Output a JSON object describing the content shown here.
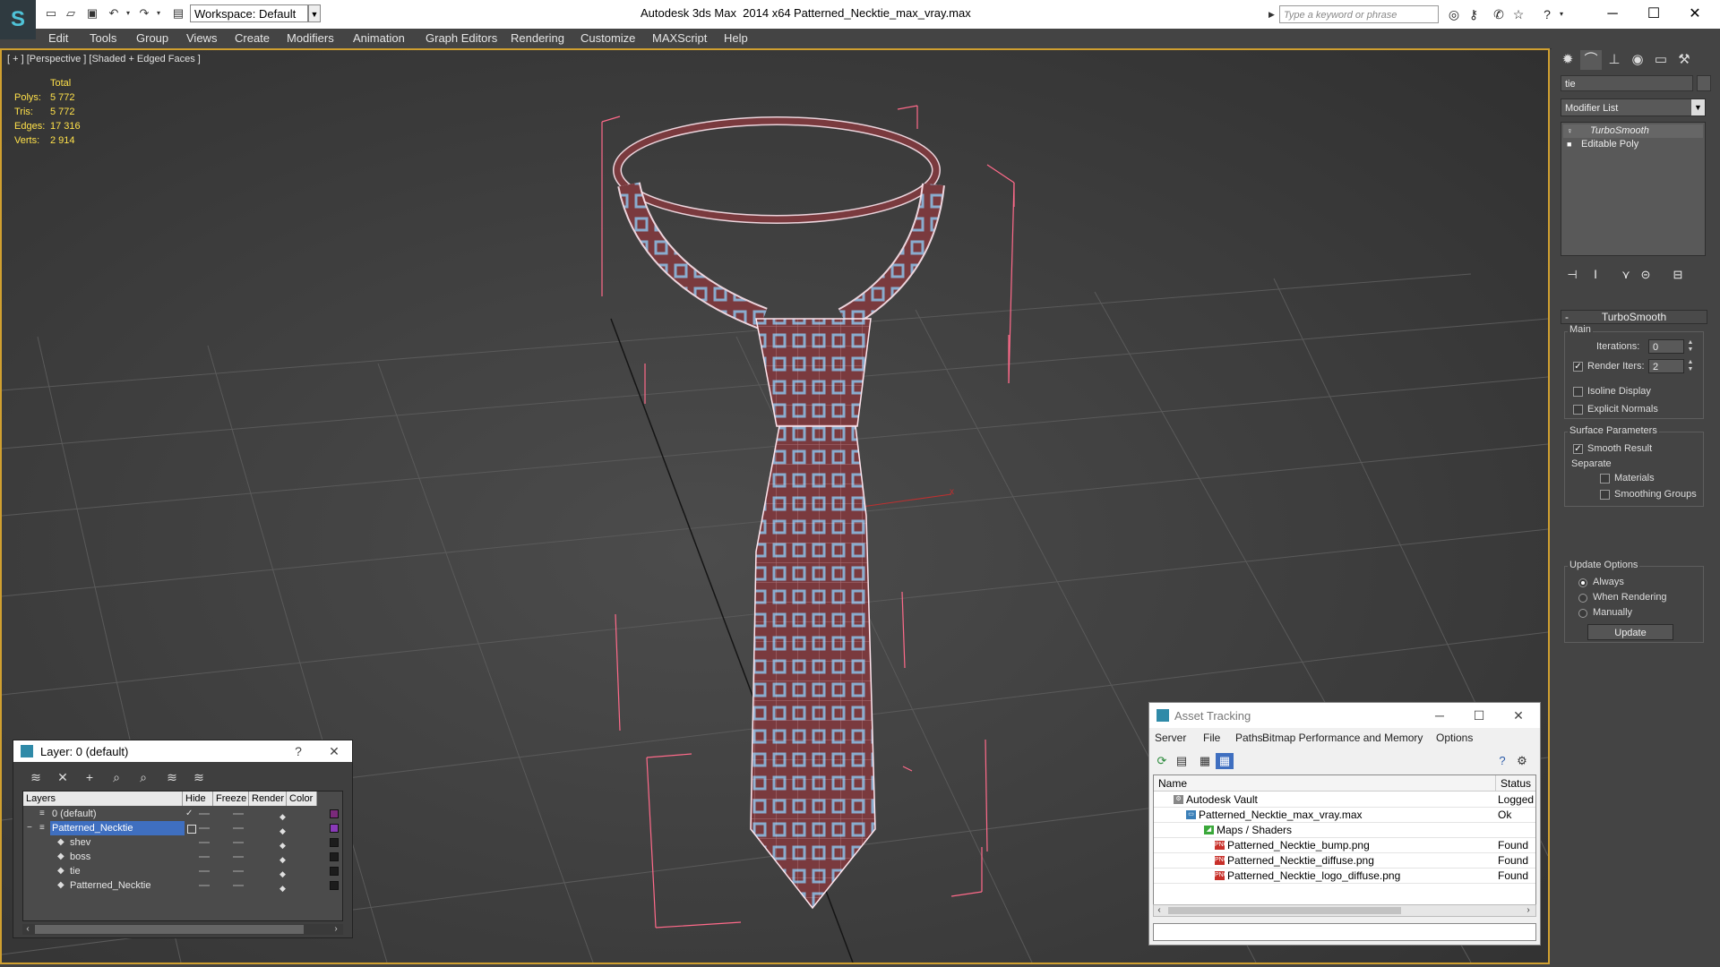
{
  "title_bar": {
    "app_title": "Autodesk 3ds Max  2014 x64",
    "file_title": "Patterned_Necktie_max_vray.max",
    "workspace": "Workspace: Default",
    "search_placeholder": "Type a keyword or phrase"
  },
  "menu": [
    "Edit",
    "Tools",
    "Group",
    "Views",
    "Create",
    "Modifiers",
    "Animation",
    "Graph Editors",
    "Rendering",
    "Customize",
    "MAXScript",
    "Help"
  ],
  "viewport": {
    "label": "[ + ] [Perspective ] [Shaded + Edged Faces ]",
    "stats": {
      "total_label": "Total",
      "rows": [
        {
          "label": "Polys:",
          "value": "5 772"
        },
        {
          "label": "Tris:",
          "value": "5 772"
        },
        {
          "label": "Edges:",
          "value": "17 316"
        },
        {
          "label": "Verts:",
          "value": "2 914"
        }
      ]
    },
    "axis_label": "x"
  },
  "command_panel": {
    "object_name": "tie",
    "modifier_list": "Modifier List",
    "stack": [
      "TurboSmooth",
      "Editable Poly"
    ],
    "rollout_title": "TurboSmooth",
    "main_group": "Main",
    "iterations_label": "Iterations:",
    "iterations_value": "0",
    "render_iters_label": "Render Iters:",
    "render_iters_value": "2",
    "isoline_label": "Isoline Display",
    "explicit_normals_label": "Explicit Normals",
    "surface_group": "Surface Parameters",
    "smooth_result_label": "Smooth Result",
    "separate_label": "Separate",
    "materials_label": "Materials",
    "smoothing_groups_label": "Smoothing Groups",
    "update_group": "Update Options",
    "update_always": "Always",
    "update_when_rendering": "When Rendering",
    "update_manually": "Manually",
    "update_button": "Update"
  },
  "layer_dialog": {
    "title": "Layer: 0 (default)",
    "help": "?",
    "columns": [
      "Layers",
      "Hide",
      "Freeze",
      "Render",
      "Color"
    ],
    "rows": [
      {
        "name": "0 (default)",
        "color": "#7a2a7a"
      },
      {
        "name": "Patterned_Necktie",
        "color": "#8a3ab8"
      },
      {
        "name": "shev",
        "color": "#1c1c1c"
      },
      {
        "name": "boss",
        "color": "#1c1c1c"
      },
      {
        "name": "tie",
        "color": "#1c1c1c"
      },
      {
        "name": "Patterned_Necktie",
        "color": "#1c1c1c"
      }
    ]
  },
  "asset_dialog": {
    "title": "Asset Tracking",
    "menu": [
      "Server",
      "File",
      "Paths",
      "Bitmap Performance and Memory",
      "Options"
    ],
    "columns": [
      "Name",
      "Status"
    ],
    "rows": [
      {
        "name": "Autodesk Vault",
        "status": "Logged"
      },
      {
        "name": "Patterned_Necktie_max_vray.max",
        "status": "Ok"
      },
      {
        "name": "Maps / Shaders",
        "status": ""
      },
      {
        "name": "Patterned_Necktie_bump.png",
        "status": "Found"
      },
      {
        "name": "Patterned_Necktie_diffuse.png",
        "status": "Found"
      },
      {
        "name": "Patterned_Necktie_logo_diffuse.png",
        "status": "Found"
      }
    ]
  },
  "colors": {
    "accent_viewport_border": "#d0a030",
    "stats_text": "#ffe14a",
    "wireframe": "#ff6a8a",
    "tie_fabric": "#7a3a3e",
    "tie_pattern": "#8cc0e8",
    "selection": "#3f6fc0"
  },
  "icons": {
    "app_logo": "3ds-max-logo-icon",
    "png_file": "png-file-icon",
    "vault": "vault-icon"
  }
}
